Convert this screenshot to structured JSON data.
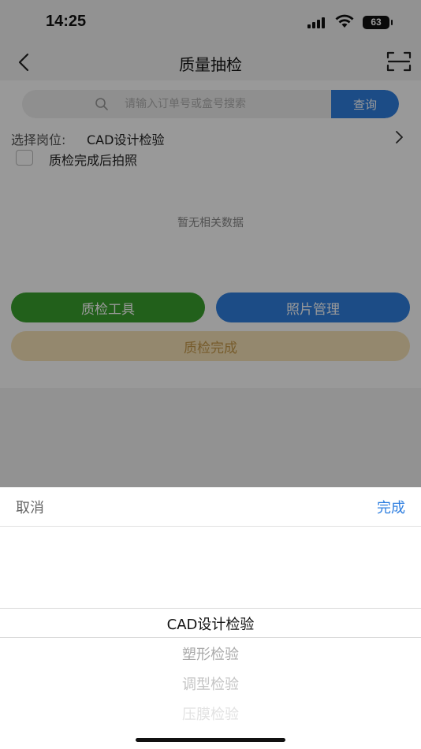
{
  "status_bar": {
    "time": "14:25",
    "battery": "63",
    "icons": [
      "signal-icon",
      "wifi-icon",
      "battery-icon"
    ]
  },
  "nav": {
    "title": "质量抽检",
    "back_icon": "chevron-left-icon",
    "scan_icon": "scan-icon"
  },
  "search": {
    "placeholder": "请输入订单号或盒号搜索",
    "value": "",
    "button_label": "查询"
  },
  "post": {
    "label": "选择岗位:",
    "value": "CAD设计检验"
  },
  "photo_after_check": {
    "label": "质检完成后拍照",
    "checked": false
  },
  "empty_state": "暂无相关数据",
  "buttons": {
    "tools": "质检工具",
    "photo_manage": "照片管理",
    "check_done": "质检完成"
  },
  "picker": {
    "cancel": "取消",
    "confirm": "完成",
    "options": [
      "CAD设计检验",
      "塑形检验",
      "调型检验",
      "压膜检验"
    ],
    "selected_index": 0
  },
  "colors": {
    "accent_blue": "#2f7fe0",
    "green": "#3aa12e",
    "done_bg": "#f7e3b8",
    "done_text": "#c69a4a"
  }
}
